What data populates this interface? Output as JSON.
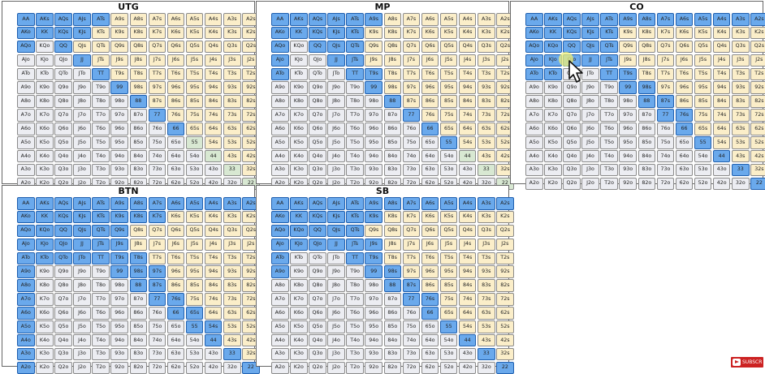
{
  "ranks": [
    "A",
    "K",
    "Q",
    "J",
    "T",
    "9",
    "8",
    "7",
    "6",
    "5",
    "4",
    "3",
    "2"
  ],
  "colors": {
    "suited": "#fbeec9",
    "offsuit": "#ecedf2",
    "pair": "#d8e8d2",
    "range": "#6aa9ec",
    "range_border": "#1f5fae",
    "badge": "#cc2222"
  },
  "positions": [
    {
      "title": "UTG",
      "range": [
        "AA",
        "KK",
        "QQ",
        "JJ",
        "TT",
        "99",
        "88",
        "77",
        "66",
        "AKs",
        "AQs",
        "AJs",
        "ATs",
        "KQs",
        "KJs",
        "AKo",
        "AQo"
      ]
    },
    {
      "title": "MP",
      "range": [
        "AA",
        "KK",
        "QQ",
        "JJ",
        "TT",
        "99",
        "88",
        "77",
        "66",
        "55",
        "AKs",
        "AQs",
        "AJs",
        "ATs",
        "A9s",
        "KQs",
        "KJs",
        "KTs",
        "QJs",
        "QTs",
        "JTs",
        "T9s",
        "AKo",
        "AQo",
        "AJo",
        "ATo"
      ]
    },
    {
      "title": "CO",
      "range": [
        "AA",
        "KK",
        "QQ",
        "JJ",
        "TT",
        "99",
        "88",
        "77",
        "66",
        "55",
        "44",
        "33",
        "22",
        "AKs",
        "AQs",
        "AJs",
        "ATs",
        "A9s",
        "A8s",
        "A7s",
        "A6s",
        "A5s",
        "A4s",
        "A3s",
        "A2s",
        "KQs",
        "KJs",
        "KTs",
        "QJs",
        "QTs",
        "JTs",
        "T9s",
        "98s",
        "87s",
        "76s",
        "AKo",
        "AQo",
        "AJo",
        "ATo",
        "KQo",
        "KJo",
        "KTo",
        "QJo"
      ]
    },
    {
      "title": "BTN",
      "range": [
        "AA",
        "KK",
        "QQ",
        "JJ",
        "TT",
        "99",
        "88",
        "77",
        "66",
        "55",
        "44",
        "33",
        "22",
        "AKs",
        "AQs",
        "AJs",
        "ATs",
        "A9s",
        "A8s",
        "A7s",
        "A6s",
        "A5s",
        "A4s",
        "A3s",
        "A2s",
        "KQs",
        "KJs",
        "KTs",
        "K9s",
        "K8s",
        "K7s",
        "QJs",
        "QTs",
        "Q9s",
        "JTs",
        "J9s",
        "T9s",
        "T8s",
        "98s",
        "97s",
        "87s",
        "76s",
        "65s",
        "54s",
        "AKo",
        "AQo",
        "AJo",
        "ATo",
        "A9o",
        "A8o",
        "A7o",
        "A6o",
        "A5o",
        "A4o",
        "A3o",
        "A2o",
        "KQo",
        "KJo",
        "KTo",
        "QJo",
        "QTo",
        "JTo"
      ]
    },
    {
      "title": "SB",
      "range": [
        "AA",
        "KK",
        "QQ",
        "JJ",
        "TT",
        "99",
        "88",
        "77",
        "66",
        "55",
        "44",
        "33",
        "22",
        "AKs",
        "AQs",
        "AJs",
        "ATs",
        "A9s",
        "A8s",
        "A7s",
        "A6s",
        "A5s",
        "A4s",
        "A3s",
        "A2s",
        "KQs",
        "KJs",
        "KTs",
        "K9s",
        "QJs",
        "QTs",
        "JTs",
        "J9s",
        "T9s",
        "98s",
        "87s",
        "76s",
        "AKo",
        "AQo",
        "AJo",
        "ATo",
        "A9o",
        "KQo",
        "KJo",
        "QJo"
      ]
    }
  ],
  "badge_label": "SUBSCR"
}
